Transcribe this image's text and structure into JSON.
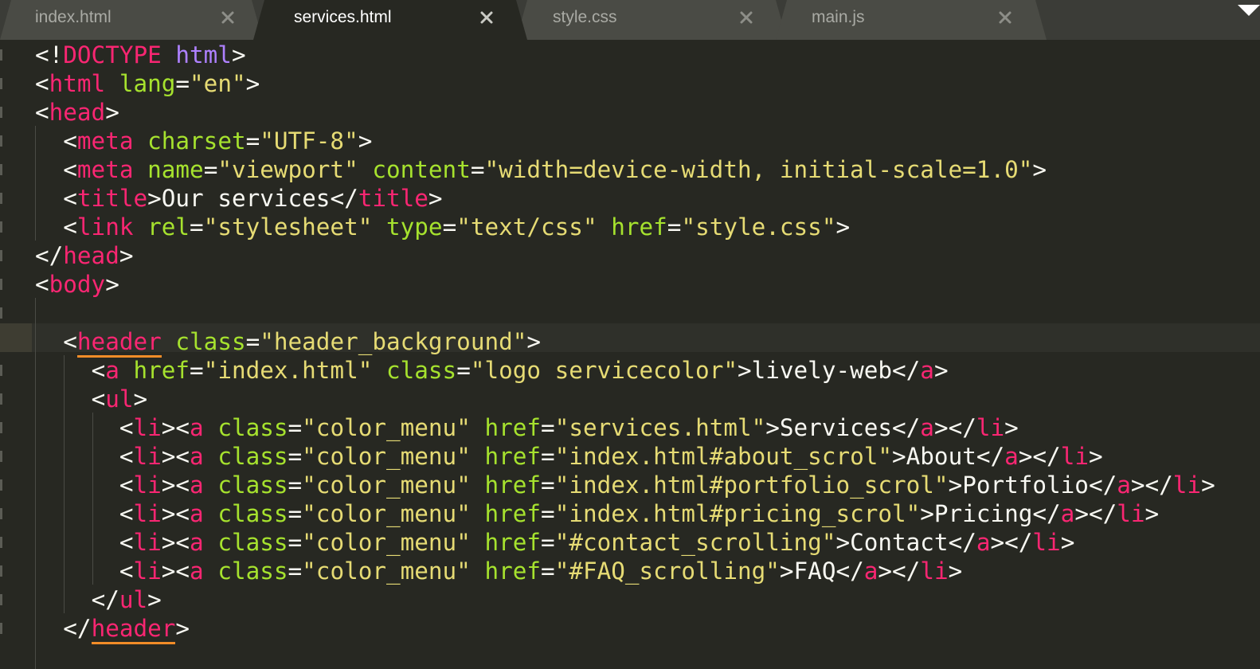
{
  "tabs": [
    {
      "label": "index.html",
      "active": false
    },
    {
      "label": "services.html",
      "active": true
    },
    {
      "label": "style.css",
      "active": false
    },
    {
      "label": "main.js",
      "active": false
    }
  ],
  "colors": {
    "background": "#272822",
    "tag": "#f92672",
    "attribute": "#a6e22e",
    "string": "#e6db74",
    "text": "#f8f8f2",
    "doctype_keyword": "#ae81ff",
    "match_highlight": "#f28c28"
  },
  "code": [
    [
      [
        "<!",
        "punct"
      ],
      [
        "DOCTYPE",
        "doctype"
      ],
      [
        " ",
        "text"
      ],
      [
        "html",
        "keyword"
      ],
      [
        ">",
        "punct"
      ]
    ],
    [
      [
        "<",
        "punct"
      ],
      [
        "html",
        "tag"
      ],
      [
        " ",
        "text"
      ],
      [
        "lang",
        "attr"
      ],
      [
        "=",
        "punct"
      ],
      [
        "\"en\"",
        "str"
      ],
      [
        ">",
        "punct"
      ]
    ],
    [
      [
        "<",
        "punct"
      ],
      [
        "head",
        "tag"
      ],
      [
        ">",
        "punct"
      ]
    ],
    [
      [
        "  ",
        "text"
      ],
      [
        "<",
        "punct"
      ],
      [
        "meta",
        "tag"
      ],
      [
        " ",
        "text"
      ],
      [
        "charset",
        "attr"
      ],
      [
        "=",
        "punct"
      ],
      [
        "\"UTF-8\"",
        "str"
      ],
      [
        ">",
        "punct"
      ]
    ],
    [
      [
        "  ",
        "text"
      ],
      [
        "<",
        "punct"
      ],
      [
        "meta",
        "tag"
      ],
      [
        " ",
        "text"
      ],
      [
        "name",
        "attr"
      ],
      [
        "=",
        "punct"
      ],
      [
        "\"viewport\"",
        "str"
      ],
      [
        " ",
        "text"
      ],
      [
        "content",
        "attr"
      ],
      [
        "=",
        "punct"
      ],
      [
        "\"width=device-width, initial-scale=1.0\"",
        "str"
      ],
      [
        ">",
        "punct"
      ]
    ],
    [
      [
        "  ",
        "text"
      ],
      [
        "<",
        "punct"
      ],
      [
        "title",
        "tag"
      ],
      [
        ">",
        "punct"
      ],
      [
        "Our services",
        "text"
      ],
      [
        "</",
        "punct"
      ],
      [
        "title",
        "tag"
      ],
      [
        ">",
        "punct"
      ]
    ],
    [
      [
        "  ",
        "text"
      ],
      [
        "<",
        "punct"
      ],
      [
        "link",
        "tag"
      ],
      [
        " ",
        "text"
      ],
      [
        "rel",
        "attr"
      ],
      [
        "=",
        "punct"
      ],
      [
        "\"stylesheet\"",
        "str"
      ],
      [
        " ",
        "text"
      ],
      [
        "type",
        "attr"
      ],
      [
        "=",
        "punct"
      ],
      [
        "\"text/css\"",
        "str"
      ],
      [
        " ",
        "text"
      ],
      [
        "href",
        "attr"
      ],
      [
        "=",
        "punct"
      ],
      [
        "\"style.css\"",
        "str"
      ],
      [
        ">",
        "punct"
      ]
    ],
    [
      [
        "</",
        "punct"
      ],
      [
        "head",
        "tag"
      ],
      [
        ">",
        "punct"
      ]
    ],
    [
      [
        "<",
        "punct"
      ],
      [
        "body",
        "tag"
      ],
      [
        ">",
        "punct"
      ]
    ],
    [],
    [
      [
        "  ",
        "text"
      ],
      [
        "<",
        "punct"
      ],
      [
        "header",
        "tag",
        "hl"
      ],
      [
        " ",
        "text"
      ],
      [
        "class",
        "attr"
      ],
      [
        "=",
        "punct"
      ],
      [
        "\"header_background\"",
        "str"
      ],
      [
        ">",
        "punct"
      ]
    ],
    [
      [
        "    ",
        "text"
      ],
      [
        "<",
        "punct"
      ],
      [
        "a",
        "tag"
      ],
      [
        " ",
        "text"
      ],
      [
        "href",
        "attr"
      ],
      [
        "=",
        "punct"
      ],
      [
        "\"index.html\"",
        "str"
      ],
      [
        " ",
        "text"
      ],
      [
        "class",
        "attr"
      ],
      [
        "=",
        "punct"
      ],
      [
        "\"logo servicecolor\"",
        "str"
      ],
      [
        ">",
        "punct"
      ],
      [
        "lively-web",
        "text"
      ],
      [
        "</",
        "punct"
      ],
      [
        "a",
        "tag"
      ],
      [
        ">",
        "punct"
      ]
    ],
    [
      [
        "    ",
        "text"
      ],
      [
        "<",
        "punct"
      ],
      [
        "ul",
        "tag"
      ],
      [
        ">",
        "punct"
      ]
    ],
    [
      [
        "      ",
        "text"
      ],
      [
        "<",
        "punct"
      ],
      [
        "li",
        "tag"
      ],
      [
        "><",
        "punct"
      ],
      [
        "a",
        "tag"
      ],
      [
        " ",
        "text"
      ],
      [
        "class",
        "attr"
      ],
      [
        "=",
        "punct"
      ],
      [
        "\"color_menu\"",
        "str"
      ],
      [
        " ",
        "text"
      ],
      [
        "href",
        "attr"
      ],
      [
        "=",
        "punct"
      ],
      [
        "\"services.html\"",
        "str"
      ],
      [
        ">",
        "punct"
      ],
      [
        "Services",
        "text"
      ],
      [
        "</",
        "punct"
      ],
      [
        "a",
        "tag"
      ],
      [
        "></",
        "punct"
      ],
      [
        "li",
        "tag"
      ],
      [
        ">",
        "punct"
      ]
    ],
    [
      [
        "      ",
        "text"
      ],
      [
        "<",
        "punct"
      ],
      [
        "li",
        "tag"
      ],
      [
        "><",
        "punct"
      ],
      [
        "a",
        "tag"
      ],
      [
        " ",
        "text"
      ],
      [
        "class",
        "attr"
      ],
      [
        "=",
        "punct"
      ],
      [
        "\"color_menu\"",
        "str"
      ],
      [
        " ",
        "text"
      ],
      [
        "href",
        "attr"
      ],
      [
        "=",
        "punct"
      ],
      [
        "\"index.html#about_scrol\"",
        "str"
      ],
      [
        ">",
        "punct"
      ],
      [
        "About",
        "text"
      ],
      [
        "</",
        "punct"
      ],
      [
        "a",
        "tag"
      ],
      [
        "></",
        "punct"
      ],
      [
        "li",
        "tag"
      ],
      [
        ">",
        "punct"
      ]
    ],
    [
      [
        "      ",
        "text"
      ],
      [
        "<",
        "punct"
      ],
      [
        "li",
        "tag"
      ],
      [
        "><",
        "punct"
      ],
      [
        "a",
        "tag"
      ],
      [
        " ",
        "text"
      ],
      [
        "class",
        "attr"
      ],
      [
        "=",
        "punct"
      ],
      [
        "\"color_menu\"",
        "str"
      ],
      [
        " ",
        "text"
      ],
      [
        "href",
        "attr"
      ],
      [
        "=",
        "punct"
      ],
      [
        "\"index.html#portfolio_scrol\"",
        "str"
      ],
      [
        ">",
        "punct"
      ],
      [
        "Portfolio",
        "text"
      ],
      [
        "</",
        "punct"
      ],
      [
        "a",
        "tag"
      ],
      [
        "></",
        "punct"
      ],
      [
        "li",
        "tag"
      ],
      [
        ">",
        "punct"
      ]
    ],
    [
      [
        "      ",
        "text"
      ],
      [
        "<",
        "punct"
      ],
      [
        "li",
        "tag"
      ],
      [
        "><",
        "punct"
      ],
      [
        "a",
        "tag"
      ],
      [
        " ",
        "text"
      ],
      [
        "class",
        "attr"
      ],
      [
        "=",
        "punct"
      ],
      [
        "\"color_menu\"",
        "str"
      ],
      [
        " ",
        "text"
      ],
      [
        "href",
        "attr"
      ],
      [
        "=",
        "punct"
      ],
      [
        "\"index.html#pricing_scrol\"",
        "str"
      ],
      [
        ">",
        "punct"
      ],
      [
        "Pricing",
        "text"
      ],
      [
        "</",
        "punct"
      ],
      [
        "a",
        "tag"
      ],
      [
        "></",
        "punct"
      ],
      [
        "li",
        "tag"
      ],
      [
        ">",
        "punct"
      ]
    ],
    [
      [
        "      ",
        "text"
      ],
      [
        "<",
        "punct"
      ],
      [
        "li",
        "tag"
      ],
      [
        "><",
        "punct"
      ],
      [
        "a",
        "tag"
      ],
      [
        " ",
        "text"
      ],
      [
        "class",
        "attr"
      ],
      [
        "=",
        "punct"
      ],
      [
        "\"color_menu\"",
        "str"
      ],
      [
        " ",
        "text"
      ],
      [
        "href",
        "attr"
      ],
      [
        "=",
        "punct"
      ],
      [
        "\"#contact_scrolling\"",
        "str"
      ],
      [
        ">",
        "punct"
      ],
      [
        "Contact",
        "text"
      ],
      [
        "</",
        "punct"
      ],
      [
        "a",
        "tag"
      ],
      [
        "></",
        "punct"
      ],
      [
        "li",
        "tag"
      ],
      [
        ">",
        "punct"
      ]
    ],
    [
      [
        "      ",
        "text"
      ],
      [
        "<",
        "punct"
      ],
      [
        "li",
        "tag"
      ],
      [
        "><",
        "punct"
      ],
      [
        "a",
        "tag"
      ],
      [
        " ",
        "text"
      ],
      [
        "class",
        "attr"
      ],
      [
        "=",
        "punct"
      ],
      [
        "\"color_menu\"",
        "str"
      ],
      [
        " ",
        "text"
      ],
      [
        "href",
        "attr"
      ],
      [
        "=",
        "punct"
      ],
      [
        "\"#FAQ_scrolling\"",
        "str"
      ],
      [
        ">",
        "punct"
      ],
      [
        "FAQ",
        "text"
      ],
      [
        "</",
        "punct"
      ],
      [
        "a",
        "tag"
      ],
      [
        "></",
        "punct"
      ],
      [
        "li",
        "tag"
      ],
      [
        ">",
        "punct"
      ]
    ],
    [
      [
        "    ",
        "text"
      ],
      [
        "</",
        "punct"
      ],
      [
        "ul",
        "tag"
      ],
      [
        ">",
        "punct"
      ]
    ],
    [
      [
        "  ",
        "text"
      ],
      [
        "</",
        "punct"
      ],
      [
        "header",
        "tag",
        "hl"
      ],
      [
        ">",
        "punct"
      ]
    ]
  ]
}
